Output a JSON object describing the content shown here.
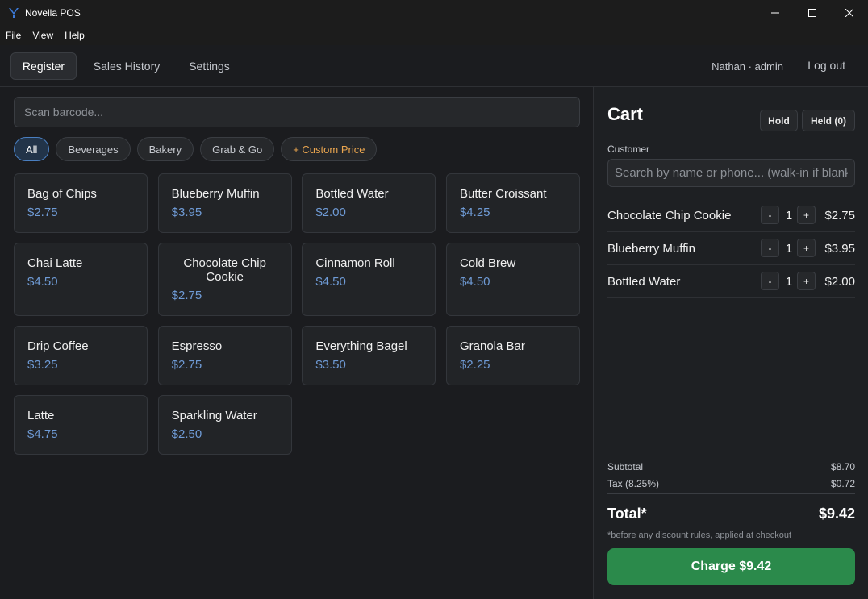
{
  "window": {
    "title": "Novella POS"
  },
  "menu": [
    "File",
    "View",
    "Help"
  ],
  "nav": {
    "tabs": [
      "Register",
      "Sales History",
      "Settings"
    ],
    "active_tab": "Register",
    "user": "Nathan · admin",
    "logout": "Log out"
  },
  "search": {
    "placeholder": "Scan barcode..."
  },
  "categories": {
    "items": [
      "All",
      "Beverages",
      "Bakery",
      "Grab & Go"
    ],
    "active": "All",
    "custom_price": "+ Custom Price"
  },
  "products": [
    {
      "name": "Bag of Chips",
      "price": "$2.75"
    },
    {
      "name": "Blueberry Muffin",
      "price": "$3.95"
    },
    {
      "name": "Bottled Water",
      "price": "$2.00"
    },
    {
      "name": "Butter Croissant",
      "price": "$4.25"
    },
    {
      "name": "Chai Latte",
      "price": "$4.50"
    },
    {
      "name": "Chocolate Chip Cookie",
      "price": "$2.75"
    },
    {
      "name": "Cinnamon Roll",
      "price": "$4.50"
    },
    {
      "name": "Cold Brew",
      "price": "$4.50"
    },
    {
      "name": "Drip Coffee",
      "price": "$3.25"
    },
    {
      "name": "Espresso",
      "price": "$2.75"
    },
    {
      "name": "Everything Bagel",
      "price": "$3.50"
    },
    {
      "name": "Granola Bar",
      "price": "$2.25"
    },
    {
      "name": "Latte",
      "price": "$4.75"
    },
    {
      "name": "Sparkling Water",
      "price": "$2.50"
    }
  ],
  "cart": {
    "title": "Cart",
    "hold_label": "Hold",
    "held_label": "Held (0)",
    "customer_label": "Customer",
    "customer_placeholder": "Search by name or phone... (walk-in if blank)",
    "decrement_label": "-",
    "increment_label": "+",
    "lines": [
      {
        "name": "Chocolate Chip Cookie",
        "qty": "1",
        "price": "$2.75"
      },
      {
        "name": "Blueberry Muffin",
        "qty": "1",
        "price": "$3.95"
      },
      {
        "name": "Bottled Water",
        "qty": "1",
        "price": "$2.00"
      }
    ],
    "subtotal_label": "Subtotal",
    "subtotal": "$8.70",
    "tax_label": "Tax (8.25%)",
    "tax": "$0.72",
    "total_label": "Total*",
    "total": "$9.42",
    "note": "*before any discount rules, applied at checkout",
    "charge_label": "Charge $9.42"
  },
  "colors": {
    "accent": "#4a7fc1",
    "price": "#6f9bd6",
    "charge": "#2b8a4b",
    "custom_price": "#e9a54f"
  }
}
